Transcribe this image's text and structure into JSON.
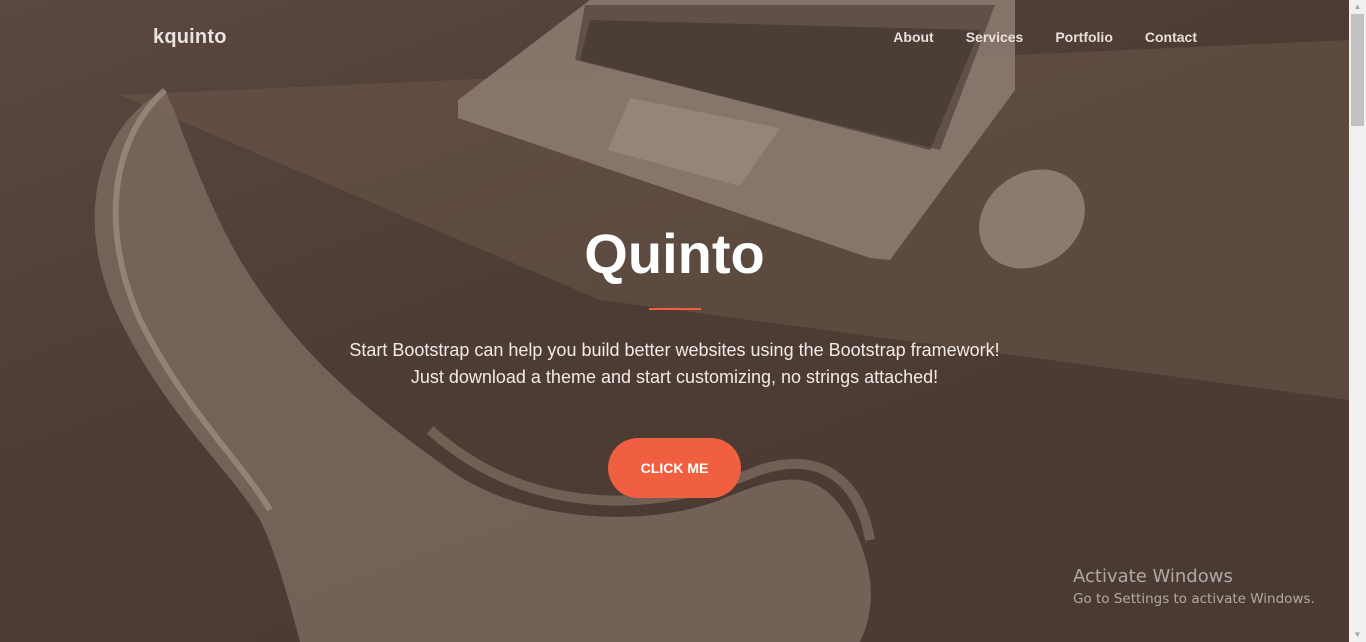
{
  "navbar": {
    "brand": "kquinto",
    "links": [
      "About",
      "Services",
      "Portfolio",
      "Contact"
    ]
  },
  "hero": {
    "title": "Quinto",
    "lead_line1": "Start Bootstrap can help you build better websites using the Bootstrap framework!",
    "lead_line2": "Just download a theme and start customizing, no strings attached!",
    "cta_label": "CLICK ME"
  },
  "colors": {
    "accent": "#f05f40",
    "overlay": "#4c3c34"
  },
  "watermark": {
    "title": "Activate Windows",
    "subtitle": "Go to Settings to activate Windows."
  }
}
